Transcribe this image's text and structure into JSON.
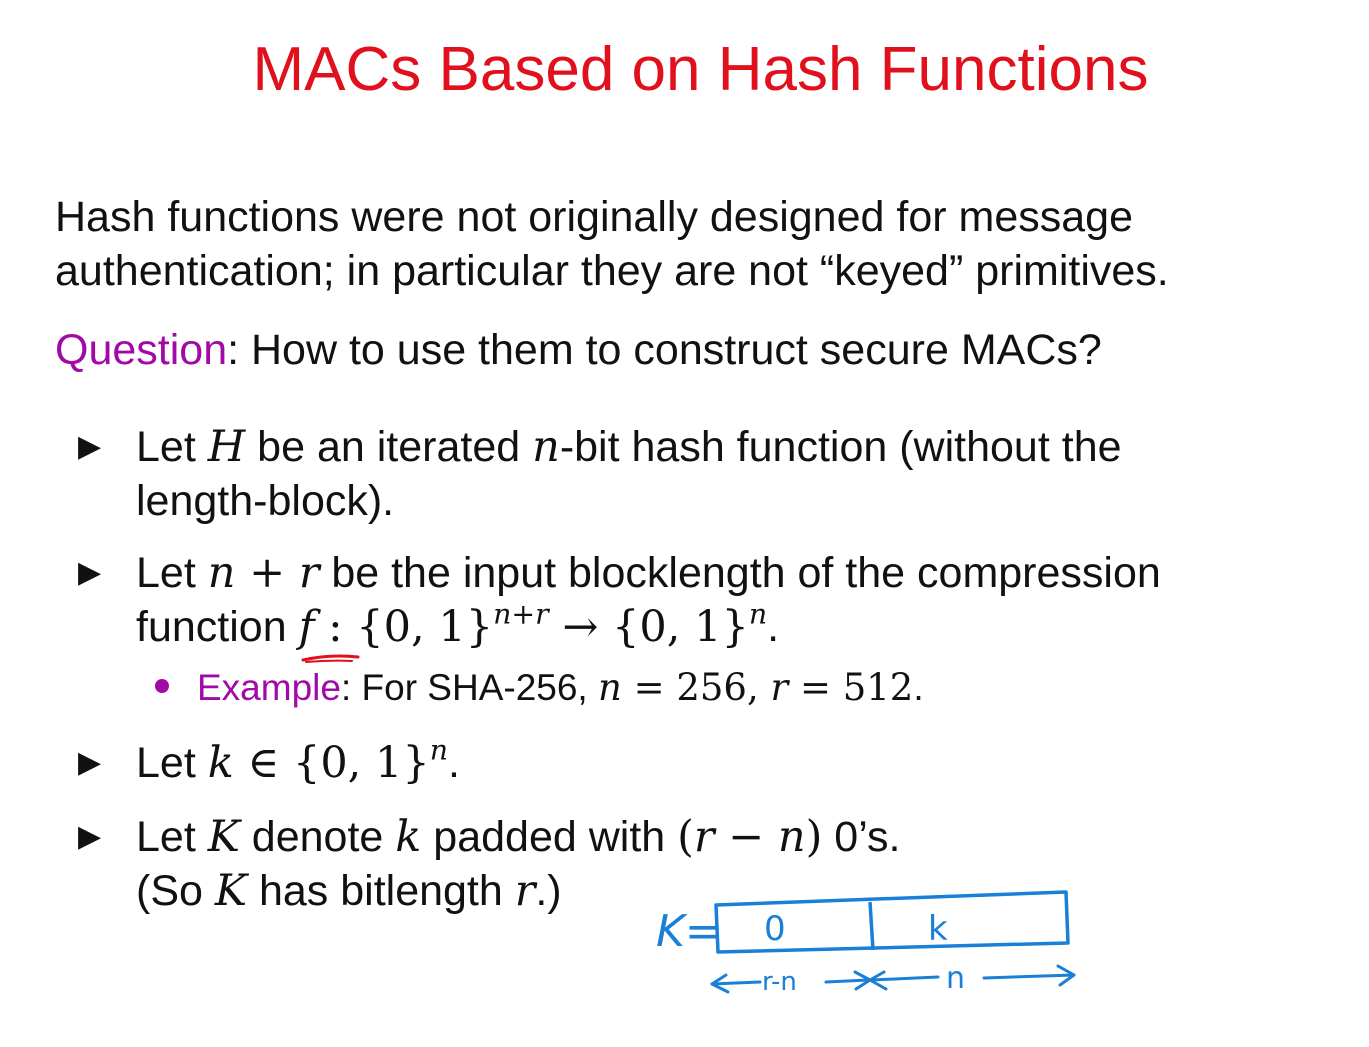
{
  "title": "MACs Based on Hash Functions",
  "intro": {
    "line1": "Hash functions were not originally designed for message",
    "line2": "authentication; in particular they are not “keyed” primitives."
  },
  "question": {
    "label": "Question",
    "text": ": How to use them to construct secure MACs?"
  },
  "bullets": {
    "b1": {
      "let": "Let ",
      "H": "H",
      "mid": " be an iterated ",
      "n": "n",
      "rest": "-bit hash function (without the",
      "line2": "length-block)."
    },
    "b2": {
      "let": "Let ",
      "n": "n",
      "plus": " + ",
      "r": "r",
      "rest": " be the input blocklength of the compression",
      "function_word": "function ",
      "f": "f",
      "colon_set": " : {0, 1}",
      "sup1": "n+r",
      "arrow_set": " → {0, 1}",
      "sup2": "n",
      "end": "."
    },
    "example": {
      "label": "Example",
      "text": ": For SHA-256, ",
      "n": "n",
      "eq1": " = 256, ",
      "r": "r",
      "eq2": " = 512",
      "end": "."
    },
    "b3": {
      "let": "Let ",
      "k": "k",
      "in_set": " ∈ {0, 1}",
      "sup": "n",
      "end": "."
    },
    "b4": {
      "let": "Let ",
      "K": "K",
      "denote": " denote ",
      "k": "k",
      "padded": " padded with ",
      "paren_open": "(",
      "r": "r",
      "minus": " − ",
      "n": "n",
      "paren_close": ")",
      "zeros": " 0’s.",
      "line2_open": "(So ",
      "K2": "K",
      "has": " has bitlength ",
      "r2": "r",
      "line2_close": ".)"
    }
  },
  "annotation": {
    "k_label": "K=",
    "cell_zero": "0",
    "cell_k": "k",
    "left_span": "r-n",
    "right_span": "n"
  },
  "colors": {
    "title": "#e0101c",
    "accent": "#a20aa8",
    "ink_blue": "#1a7fd6",
    "ink_red": "#e0101c"
  }
}
